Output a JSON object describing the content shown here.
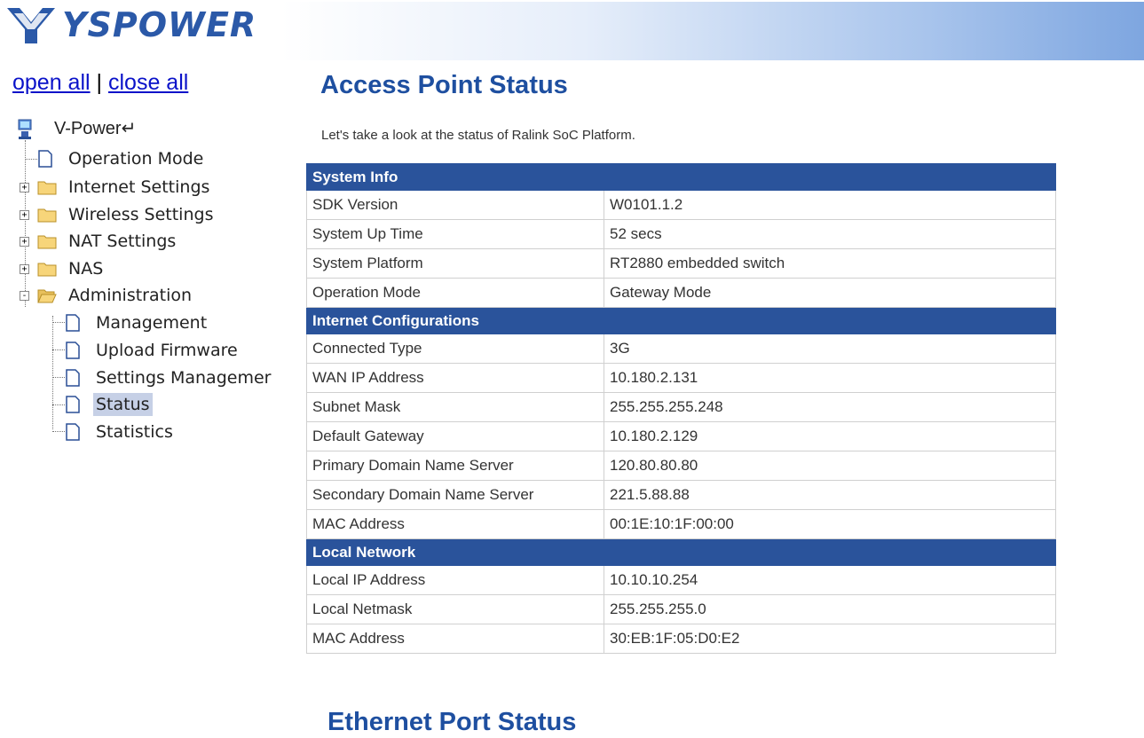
{
  "header": {
    "logo_text": "YSPOWER",
    "colors": {
      "brand": "#2b59a8",
      "section_bar": "#2a539b",
      "link": "#0a12c9",
      "title": "#1e4fa0"
    }
  },
  "sidebar": {
    "open_all": "open all",
    "separator": "|",
    "close_all": "close all",
    "root": {
      "label": "V-Power↵",
      "icon": "computer-icon"
    },
    "items": [
      {
        "label": "Operation Mode",
        "icon": "page-icon"
      },
      {
        "label": "Internet Settings",
        "icon": "folder-icon",
        "expander": "+"
      },
      {
        "label": "Wireless Settings",
        "icon": "folder-icon",
        "expander": "+"
      },
      {
        "label": "NAT Settings",
        "icon": "folder-icon",
        "expander": "+"
      },
      {
        "label": "NAS",
        "icon": "folder-icon",
        "expander": "+"
      },
      {
        "label": "Administration",
        "icon": "folder-open-icon",
        "expander": "-"
      }
    ],
    "admin_children": [
      {
        "label": "Management",
        "icon": "page-icon"
      },
      {
        "label": "Upload Firmware",
        "icon": "page-icon"
      },
      {
        "label": "Settings Managemer",
        "icon": "page-icon"
      },
      {
        "label": "Status",
        "icon": "page-icon",
        "selected": true
      },
      {
        "label": "Statistics",
        "icon": "page-icon"
      }
    ]
  },
  "main": {
    "title": "Access Point Status",
    "intro": "Let's take a look at the status of Ralink SoC Platform.",
    "sections": [
      {
        "heading": "System Info",
        "rows": [
          {
            "key": "SDK Version",
            "value": "W0101.1.2"
          },
          {
            "key": "System Up Time",
            "value": "52 secs"
          },
          {
            "key": "System Platform",
            "value": "RT2880 embedded switch"
          },
          {
            "key": "Operation Mode",
            "value": "Gateway Mode"
          }
        ]
      },
      {
        "heading": "Internet Configurations",
        "rows": [
          {
            "key": "Connected Type",
            "value": "3G"
          },
          {
            "key": "WAN IP Address",
            "value": "10.180.2.131"
          },
          {
            "key": "Subnet Mask",
            "value": "255.255.255.248"
          },
          {
            "key": "Default Gateway",
            "value": "10.180.2.129"
          },
          {
            "key": "Primary Domain Name Server",
            "value": "120.80.80.80"
          },
          {
            "key": "Secondary Domain Name Server",
            "value": "221.5.88.88"
          },
          {
            "key": "MAC Address",
            "value": "00:1E:10:1F:00:00"
          }
        ]
      },
      {
        "heading": "Local Network",
        "rows": [
          {
            "key": "Local IP Address",
            "value": "10.10.10.254"
          },
          {
            "key": "Local Netmask",
            "value": "255.255.255.0"
          },
          {
            "key": "MAC Address",
            "value": "30:EB:1F:05:D0:E2"
          }
        ]
      }
    ],
    "section2_title": "Ethernet Port Status"
  }
}
